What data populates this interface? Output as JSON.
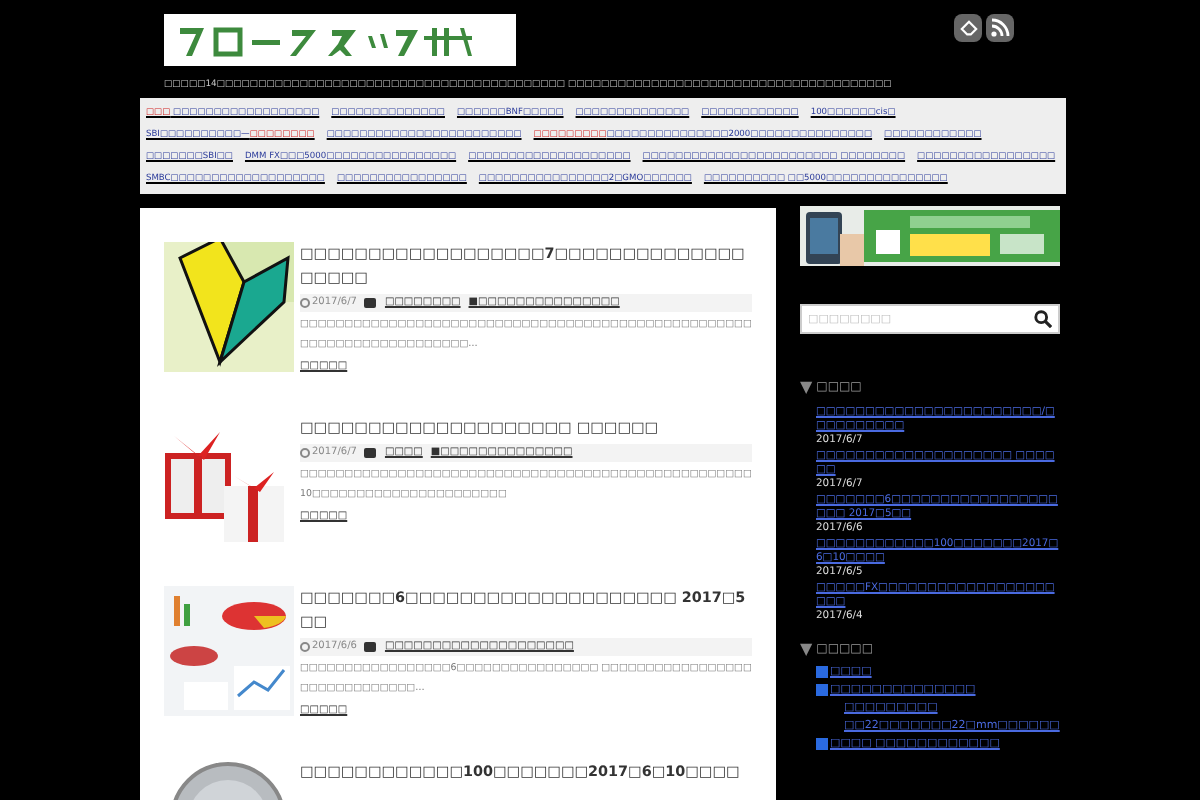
{
  "header": {
    "tagline": "□□□□□14□□□□□□□□□□□□□□□□□□□□□□□□□□□□□□□□□□□□□□□□□□ □□□□□□□□□□□□□□□□□□□□□□□□□□□□□□□□□□□□□□□"
  },
  "nav": [
    {
      "parts": [
        {
          "text": "□□□",
          "emphasis": true
        },
        {
          "text": " □□□□□□□□□□□□□□□□□□",
          "emphasis": false
        }
      ]
    },
    {
      "parts": [
        {
          "text": "□□□□□□□□□□□□□□",
          "emphasis": false
        }
      ]
    },
    {
      "parts": [
        {
          "text": "□□□□□□BNF□□□□□",
          "emphasis": false
        }
      ]
    },
    {
      "parts": [
        {
          "text": "□□□□□□□□□□□□□□",
          "emphasis": false
        }
      ]
    },
    {
      "parts": [
        {
          "text": "□□□□□□□□□□□□",
          "emphasis": false
        }
      ]
    },
    {
      "parts": [
        {
          "text": "100□□□□□□cis□",
          "emphasis": false
        }
      ]
    },
    {
      "parts": [
        {
          "text": "SBI□□□□□□□□□□—",
          "emphasis": false
        },
        {
          "text": "□□□□□□□□",
          "emphasis": true
        }
      ]
    },
    {
      "parts": [
        {
          "text": "□□□□□□□□□□□□□□□□□□□□□□□□",
          "emphasis": false
        }
      ]
    },
    {
      "parts": [
        {
          "text": "□□□□□□□□□",
          "emphasis": true
        },
        {
          "text": "□□□□□□□□□□□□□□□2000□□□□□□□□□□□□□□□",
          "emphasis": false
        }
      ]
    },
    {
      "parts": [
        {
          "text": "□□□□□□□□□□□□",
          "emphasis": false
        }
      ]
    },
    {
      "parts": [
        {
          "text": "□□□□□□□SBI□□",
          "emphasis": false
        }
      ]
    },
    {
      "parts": [
        {
          "text": "DMM FX□□□5000□□□□□□□□□□□□□□□□",
          "emphasis": false
        }
      ]
    },
    {
      "parts": [
        {
          "text": "□□□□□□□□□□□□□□□□□□□□",
          "emphasis": false
        }
      ]
    },
    {
      "parts": [
        {
          "text": "□□□□□□□□□□□□□□□□□□□□□□□□ □□□□□□□□",
          "emphasis": false
        }
      ]
    },
    {
      "parts": [
        {
          "text": "□□□□□□□□□□□□□□□□□",
          "emphasis": false
        }
      ]
    },
    {
      "parts": [
        {
          "text": "SMBC□□□□□□□□□□□□□□□□□□□",
          "emphasis": false
        }
      ]
    },
    {
      "parts": [
        {
          "text": "□□□□□□□□□□□□□□□□",
          "emphasis": false
        }
      ]
    },
    {
      "parts": [
        {
          "text": "□□□□□□□□□□□□□□□□2□GMO□□□□□□",
          "emphasis": false
        }
      ]
    },
    {
      "parts": [
        {
          "text": "□□□□□□□□□□ □□5000□□□□□□□□□□□□□□□",
          "emphasis": false
        }
      ]
    }
  ],
  "posts": [
    {
      "kind": "picture",
      "title": "□□□□□□□□□□□□□□□□□□7□□□□□□□□□□□□□□□□□□□",
      "date": "2017/6/7",
      "categories": [
        "□□□□□□□□",
        "■□□□□□□□□□□□□□□□"
      ],
      "excerpt": "□□□□□□□□□□□□□□□□□□□□□□□□□□□□□□□□□□□□□□□□□□□□□□□□□□□□□□□□□□□□□□□□□□□□□□…",
      "more": "□□□□□"
    },
    {
      "kind": "picture",
      "title": "□□□□□□□□□□□□□□□□□□□□ □□□□□□",
      "date": "2017/6/7",
      "categories": [
        "□□□□",
        "■□□□□□□□□□□□□□□"
      ],
      "excerpt": "□□□□□□□□□□□□□□□□□□□□□□□□□□□□□□□□□□□□□□□□□□□□□□□□□□□10□□□□□□□□□□□□□□□□□□□□□□",
      "more": "□□□□□"
    },
    {
      "kind": "picture",
      "title": "□□□□□□□6□□□□□□□□□□□□□□□□□□□□ 2017□5□□",
      "date": "2017/6/6",
      "categories": [
        "□□□□□□□□□□□□□□□□□□□□"
      ],
      "excerpt": "□□□□□□□□□□□□□□□□□6□□□□□□□□□□□□□□□□ □□□□□□□□□□□□□□□□□□□□□□□□□□□□□□…",
      "more": "□□□□□"
    },
    {
      "kind": "picture",
      "title": "□□□□□□□□□□□□100□□□□□□□2017□6□10□□□□"
    }
  ],
  "sidebar": {
    "search": {
      "placeholder": "□□□□□□□□"
    },
    "recent_heading": {
      "marker": "▼",
      "text": "□□□□"
    },
    "recent": [
      {
        "title": "□□□□□□□□□□□□□□□□□□□□□□□/□□□□□□□□□□",
        "date": "2017/6/7"
      },
      {
        "title": "□□□□□□□□□□□□□□□□□□□□ □□□□□□",
        "date": "2017/6/7"
      },
      {
        "title": "□□□□□□□6□□□□□□□□□□□□□□□□□□□□ 2017□5□□",
        "date": "2017/6/6"
      },
      {
        "title": "□□□□□□□□□□□□100□□□□□□□2017□6□10□□□□",
        "date": "2017/6/5"
      },
      {
        "title": "□□□□□FX□□□□□□□□□□□□□□□□□□□□□",
        "date": "2017/6/4"
      }
    ],
    "category_heading": {
      "marker": "▼",
      "text": "□□□□□"
    },
    "categories": [
      {
        "label": "□□□□"
      },
      {
        "label": "□□□□□□□□□□□□□□",
        "children": [
          {
            "label": "□□□□□□□□□"
          },
          {
            "label": "□□22□□□□□□□22□mm□□□□□□"
          }
        ]
      },
      {
        "label": "□□□□ □□□□□□□□□□□□"
      }
    ]
  }
}
